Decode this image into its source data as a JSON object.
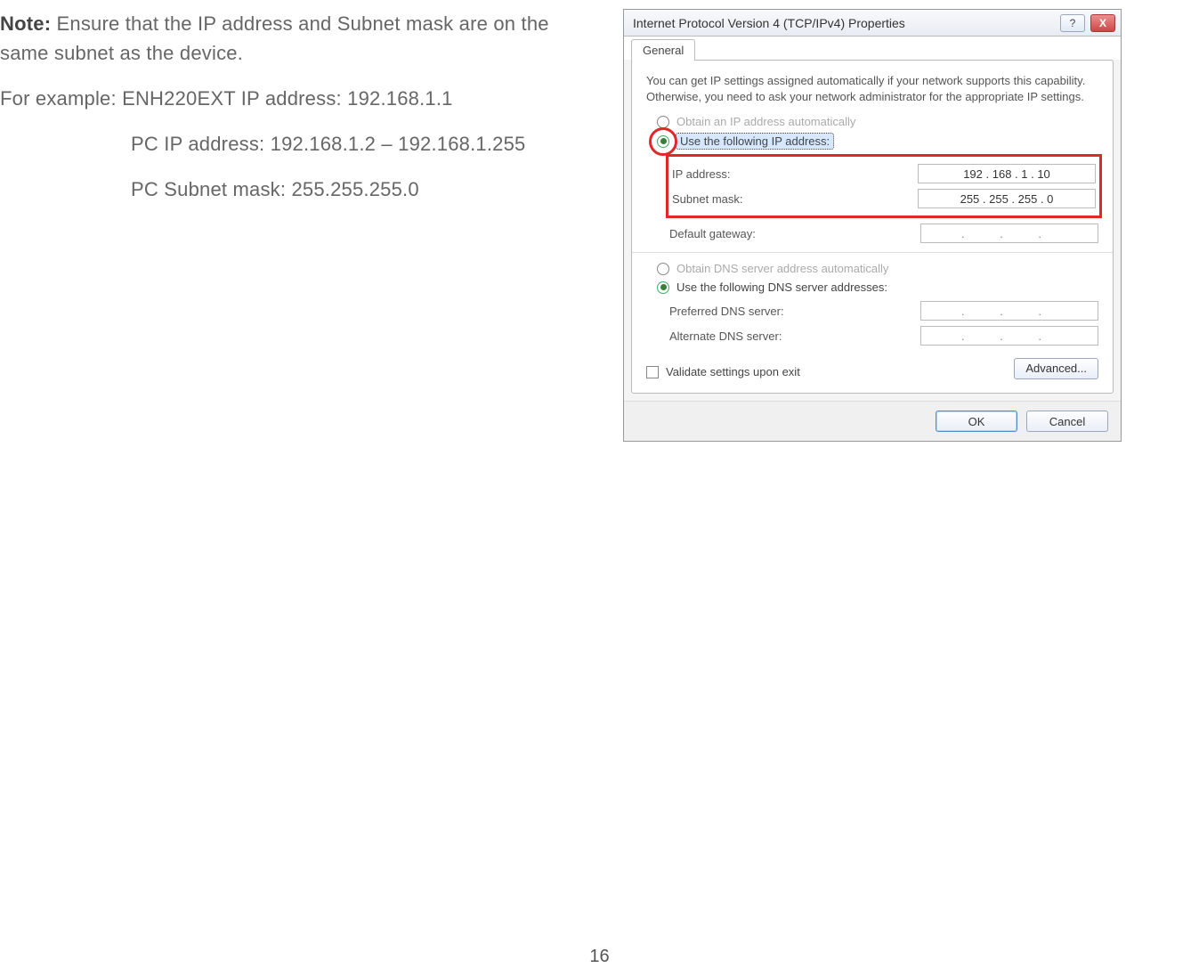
{
  "body": {
    "note_label": "Note:",
    "note_text": " Ensure that the IP address and Subnet mask are on the same subnet as the device.",
    "example_prefix": "For example: ",
    "example_line1": "ENH220EXT IP address: 192.168.1.1",
    "example_line2": "PC IP address: 192.168.1.2 – 192.168.1.255",
    "example_line3": "PC Subnet mask: 255.255.255.0"
  },
  "dialog": {
    "title": "Internet Protocol Version 4 (TCP/IPv4) Properties",
    "help_icon": "?",
    "close_icon": "X",
    "tab": "General",
    "description": "You can get IP settings assigned automatically if your network supports this capability. Otherwise, you need to ask your network administrator for the appropriate IP settings.",
    "radio_auto_ip": "Obtain an IP address automatically",
    "radio_use_ip": "Use the following IP address:",
    "fields": {
      "ip_label": "IP address:",
      "ip_value": "192 . 168 .  1  . 10",
      "subnet_label": "Subnet mask:",
      "subnet_value": "255 . 255 . 255 .  0",
      "gateway_label": "Default gateway:",
      "gateway_value": ".   .   ."
    },
    "radio_auto_dns": "Obtain DNS server address automatically",
    "radio_use_dns": "Use the following DNS server addresses:",
    "dns_fields": {
      "preferred_label": "Preferred DNS server:",
      "preferred_value": ".   .   .",
      "alternate_label": "Alternate DNS server:",
      "alternate_value": ".   .   ."
    },
    "validate_checkbox": "Validate settings upon exit",
    "advanced_button": "Advanced...",
    "ok_button": "OK",
    "cancel_button": "Cancel"
  },
  "page_number": "16"
}
